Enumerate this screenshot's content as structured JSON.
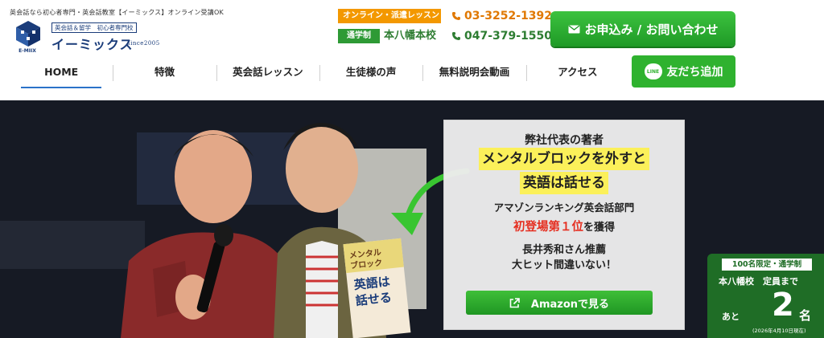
{
  "header": {
    "tagline": "英会話なら初心者専門・英会話教室【イーミックス】オンライン受講OK",
    "logo": {
      "mark_text": "E-MIIX",
      "sub": "英会話＆留学　初心者専門校",
      "name": "イーミックス",
      "since": "since2005"
    },
    "contact": {
      "online_badge": "オンライン・派遣レッスン",
      "online_phone": "03-3252-1392",
      "commute_badge": "通学制",
      "school_name": "本八幡本校",
      "school_phone": "047-379-1550"
    },
    "cta_label": "お申込み / お問い合わせ"
  },
  "nav": {
    "items": [
      {
        "label": "HOME"
      },
      {
        "label": "特徴"
      },
      {
        "label": "英会話レッスン"
      },
      {
        "label": "生徒様の声"
      },
      {
        "label": "無料説明会動画"
      },
      {
        "label": "アクセス"
      }
    ],
    "line_icon_text": "LINE",
    "line_button_label": "友だち追加"
  },
  "hero": {
    "book_text": {
      "spine_1": "メンタル",
      "spine_2": "ブロック",
      "title_1": "英語は",
      "title_2": "話せる"
    },
    "book_panel": {
      "line1": "弊社代表の著者",
      "highlight1": "メンタルブロックを外すと",
      "highlight2": "英語は話せる",
      "line4": "アマゾンランキング英会話部門",
      "red_text": "初登場第１位",
      "line5_suffix": "を獲得",
      "line6a": "長井秀和さん推薦",
      "line6b": "大ヒット間違いない！",
      "amazon_label": "Amazonで見る"
    },
    "seat_box": {
      "tag": "100名限定・通学制",
      "school": "本八幡校　定員まで",
      "ato": "あと",
      "number": "2",
      "mei": "名",
      "date": "(2026年4月10日現在)"
    }
  },
  "colors": {
    "brand_blue": "#1a3c7a",
    "orange": "#f39800",
    "green": "#2e9a35",
    "highlight_yellow": "#fbf05a",
    "red": "#e52e20",
    "seat_green": "#1f6d26"
  }
}
